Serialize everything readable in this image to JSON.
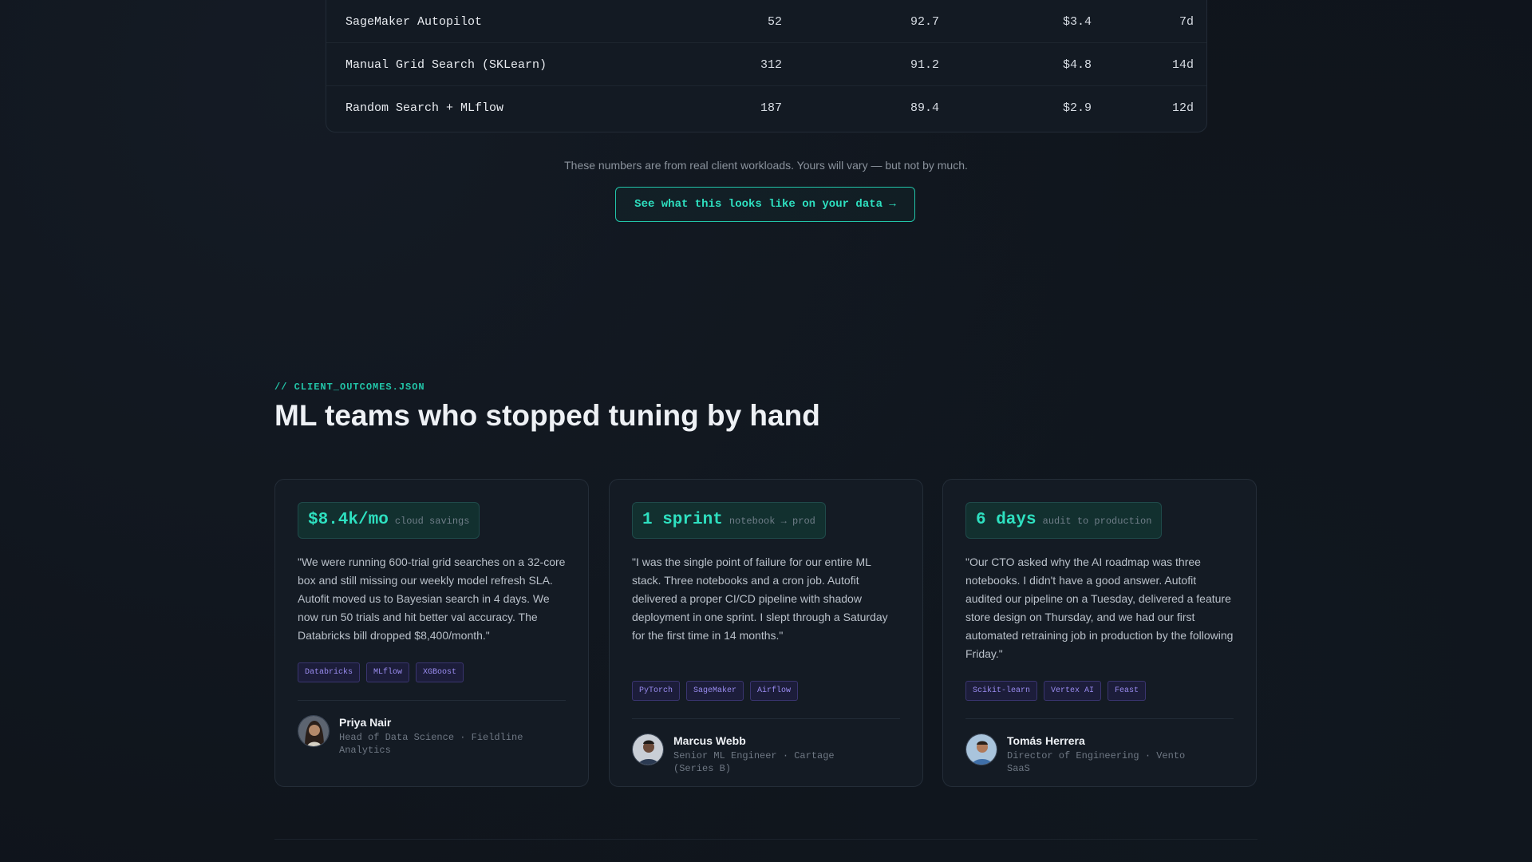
{
  "comparison_table": {
    "rows": [
      {
        "method": "SageMaker Autopilot",
        "c1": "52",
        "c2": "92.7",
        "c3": "$3.4",
        "c4": "7d"
      },
      {
        "method": "Manual Grid Search (SKLearn)",
        "c1": "312",
        "c2": "91.2",
        "c3": "$4.8",
        "c4": "14d"
      },
      {
        "method": "Random Search + MLflow",
        "c1": "187",
        "c2": "89.4",
        "c3": "$2.9",
        "c4": "12d"
      }
    ],
    "note": "These numbers are from real client workloads. Yours will vary — but not by much.",
    "cta_label": "See what this looks like on your data →"
  },
  "outcomes": {
    "eyebrow": "// CLIENT_OUTCOMES.JSON",
    "title": "ML teams who stopped tuning by hand",
    "cards": [
      {
        "metric_value": "$8.4k/mo",
        "metric_caption": "cloud savings",
        "quote": "\"We were running 600-trial grid searches on a 32-core box and still missing our weekly model refresh SLA. Autofit moved us to Bayesian search in 4 days. We now run 50 trials and hit better val accuracy. The Databricks bill dropped $8,400/month.\"",
        "tags": [
          "Databricks",
          "MLflow",
          "XGBoost"
        ],
        "name": "Priya Nair",
        "role": "Head of Data Science · Fieldline Analytics"
      },
      {
        "metric_value": "1 sprint",
        "metric_caption": "notebook → prod",
        "quote": "\"I was the single point of failure for our entire ML stack. Three notebooks and a cron job. Autofit delivered a proper CI/CD pipeline with shadow deployment in one sprint. I slept through a Saturday for the first time in 14 months.\"",
        "tags": [
          "PyTorch",
          "SageMaker",
          "Airflow"
        ],
        "name": "Marcus Webb",
        "role": "Senior ML Engineer · Cartage (Series B)"
      },
      {
        "metric_value": "6 days",
        "metric_caption": "audit to production",
        "quote": "\"Our CTO asked why the AI roadmap was three notebooks. I didn't have a good answer. Autofit audited our pipeline on a Tuesday, delivered a feature store design on Thursday, and we had our first automated retraining job in production by the following Friday.\"",
        "tags": [
          "Scikit-learn",
          "Vertex AI",
          "Feast"
        ],
        "name": "Tomás Herrera",
        "role": "Director of Engineering · Vento SaaS"
      }
    ]
  },
  "colors": {
    "background": "#0f141b",
    "accent": "#22c4a8",
    "tag_purple": "#9a8cf0"
  }
}
